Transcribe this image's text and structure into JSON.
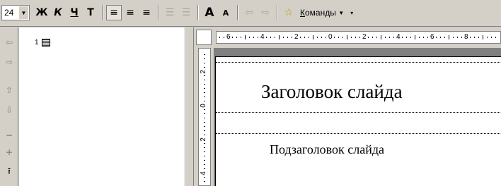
{
  "toolbar": {
    "font_size": "24",
    "bold": "Ж",
    "italic": "К",
    "underline": "Ч",
    "shadow": "Т",
    "align_left": "≡",
    "align_center": "≡",
    "align_right": "≡",
    "numbering": "☰",
    "bullets": "☰",
    "increase_font": "A",
    "decrease_font": "A",
    "promote": "⇦",
    "demote": "⇨",
    "animation": "☆",
    "commands_label": "Команды",
    "commands_hotkey": "К",
    "commands_rest": "оманды"
  },
  "outline": {
    "slide_number": "1"
  },
  "ruler": {
    "horizontal_numbers": [
      "6",
      "4",
      "2",
      "0",
      "2",
      "4",
      "6",
      "8"
    ],
    "vertical_numbers": [
      "2",
      "0",
      "2",
      "4"
    ]
  },
  "slide": {
    "title_placeholder": "Заголовок слайда",
    "subtitle_placeholder": "Подзаголовок слайда"
  },
  "colors": {
    "chrome": "#d4d0c8",
    "workspace": "#808080"
  }
}
